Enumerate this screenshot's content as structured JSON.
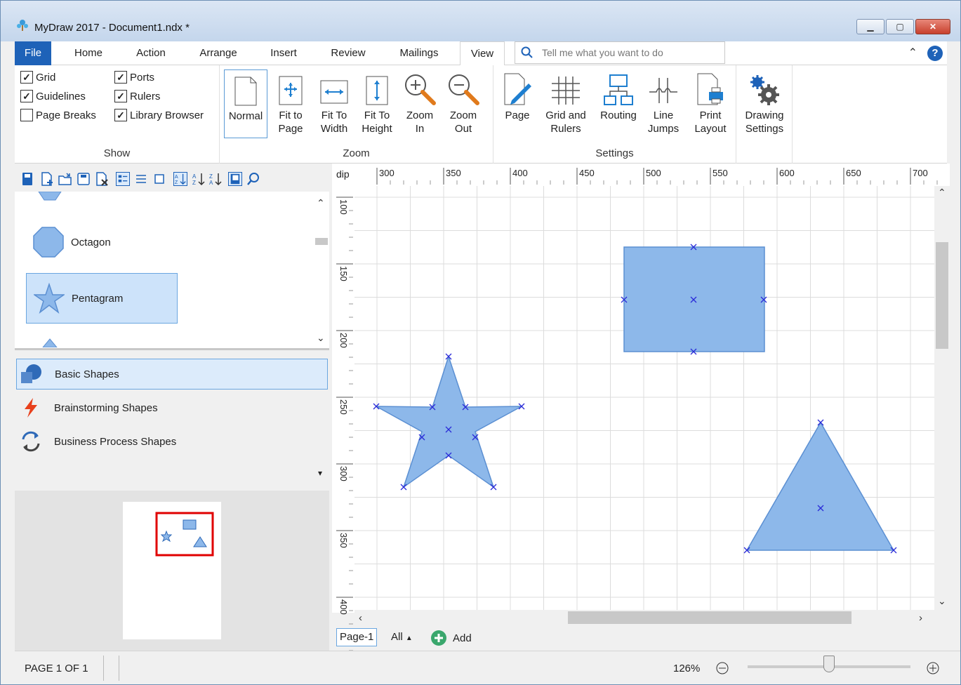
{
  "app": {
    "title": "MyDraw 2017 - Document1.ndx *"
  },
  "tabs": [
    "File",
    "Home",
    "Action",
    "Arrange",
    "Insert",
    "Review",
    "Mailings",
    "View"
  ],
  "active_tab": "View",
  "tell_me": {
    "placeholder": "Tell me what you want to do"
  },
  "ribbon": {
    "show": {
      "label": "Show",
      "checks": [
        {
          "label": "Grid",
          "checked": true
        },
        {
          "label": "Ports",
          "checked": true
        },
        {
          "label": "Guidelines",
          "checked": true
        },
        {
          "label": "Rulers",
          "checked": true
        },
        {
          "label": "Page Breaks",
          "checked": false
        },
        {
          "label": "Library Browser",
          "checked": true
        }
      ]
    },
    "zoom": {
      "label": "Zoom",
      "buttons": [
        {
          "l1": "Normal",
          "l2": ""
        },
        {
          "l1": "Fit to",
          "l2": "Page"
        },
        {
          "l1": "Fit To",
          "l2": "Width"
        },
        {
          "l1": "Fit To",
          "l2": "Height"
        },
        {
          "l1": "Zoom",
          "l2": "In"
        },
        {
          "l1": "Zoom",
          "l2": "Out"
        }
      ]
    },
    "settings": {
      "label": "Settings",
      "buttons": [
        {
          "l1": "Page",
          "l2": ""
        },
        {
          "l1": "Grid and",
          "l2": "Rulers"
        },
        {
          "l1": "Routing",
          "l2": ""
        },
        {
          "l1": "Line",
          "l2": "Jumps"
        },
        {
          "l1": "Print",
          "l2": "Layout"
        }
      ]
    },
    "drawing": {
      "l1": "Drawing",
      "l2": "Settings"
    }
  },
  "shapes": [
    "Octagon",
    "Pentagram"
  ],
  "libraries": [
    "Basic Shapes",
    "Brainstorming Shapes",
    "Business Process Shapes"
  ],
  "ruler": {
    "unit": "dip",
    "h": [
      "300",
      "350",
      "400",
      "450",
      "500",
      "550",
      "600",
      "650",
      "700"
    ],
    "v": [
      "100",
      "150",
      "200",
      "250",
      "300",
      "350",
      "400"
    ]
  },
  "pages": {
    "current": "Page-1",
    "all": "All",
    "add": "Add"
  },
  "status": {
    "page": "PAGE 1 OF 1",
    "zoom": "126%"
  },
  "zoom_slider_fraction": 0.5,
  "colors": {
    "shape_fill": "#8db8ea",
    "shape_stroke": "#5b8fd2",
    "accent": "#1e62b8",
    "marker": "#2a2ad8"
  },
  "icons": {
    "minimize": "minimize-icon",
    "maximize": "maximize-icon",
    "close": "close-icon",
    "help": "help-icon",
    "search": "search-icon"
  }
}
